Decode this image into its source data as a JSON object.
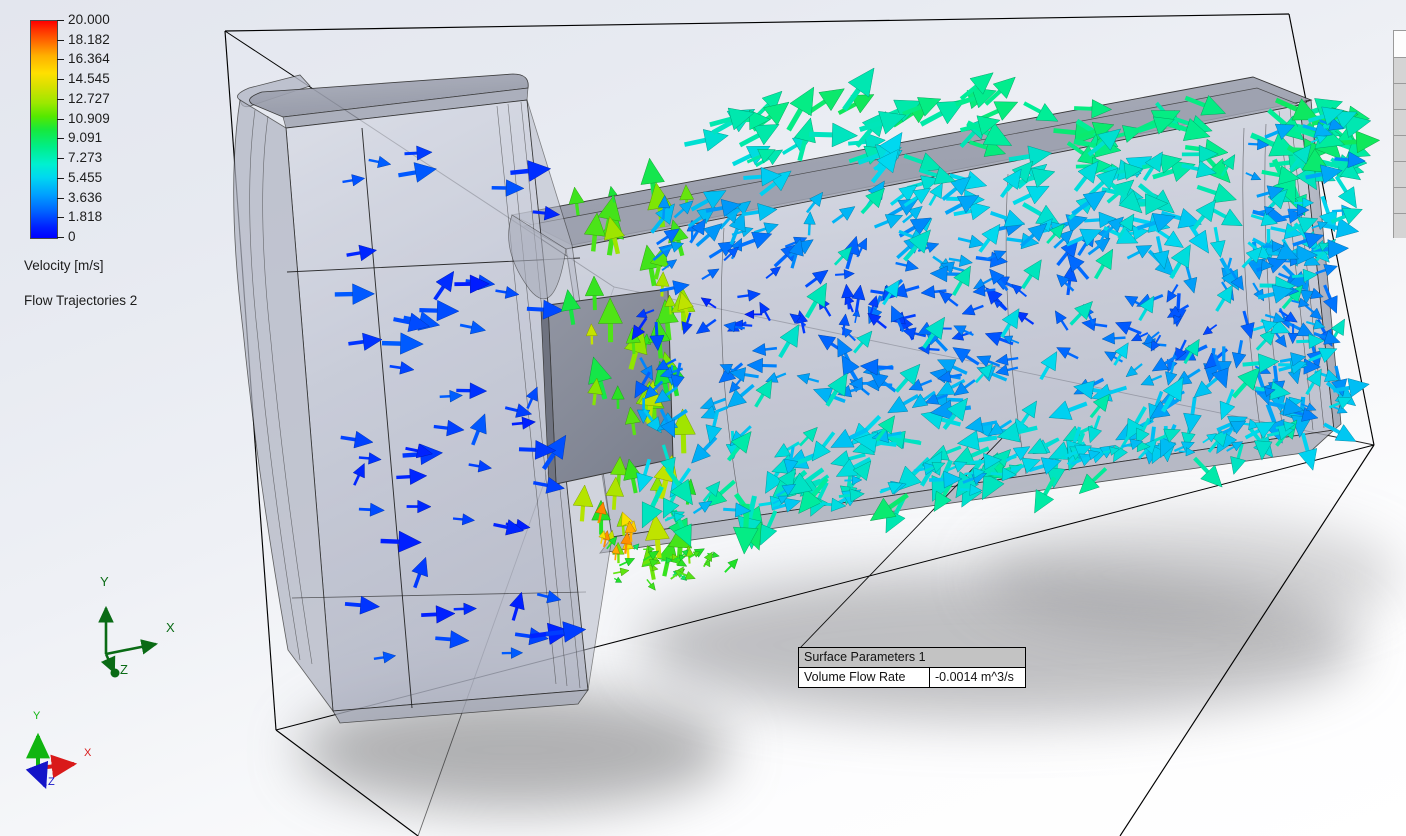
{
  "legend": {
    "bar_name": "velocity-colorbar",
    "values": [
      "20.000",
      "18.182",
      "16.364",
      "14.545",
      "12.727",
      "10.909",
      "9.091",
      "7.273",
      "5.455",
      "3.636",
      "1.818",
      "0"
    ],
    "title": "Velocity [m/s]",
    "plot_name": "Flow Trajectories 2",
    "colors": {
      "max": "#ff0000",
      "mid": "#00ee00",
      "min": "#0000ff"
    }
  },
  "triads": {
    "model": {
      "name": "model-coordinate-triad",
      "x_label": "X",
      "y_label": "Y",
      "z_label": "Z",
      "color": "#0a6b15"
    },
    "view": {
      "name": "view-orientation-triad",
      "x_label": "X",
      "y_label": "Y",
      "z_label": "Z",
      "x_color": "#d91a1a",
      "y_color": "#11b511",
      "z_color": "#1414c8"
    }
  },
  "callout": {
    "title": "Surface Parameters 1",
    "label": "Volume Flow Rate",
    "value": "-0.0014 m^3/s",
    "header_color": "#c3c3c3"
  },
  "scene": {
    "name": "flow-simulation-3d-view",
    "domain_box_color": "#000000",
    "body_color": "#b9bdcc",
    "plate_color": "#8b8f9c",
    "shadow_color": "#8a8a8a"
  },
  "chart_data": {
    "type": "heatmap",
    "title": "Velocity [m/s]",
    "subtitle": "Flow Trajectories 2",
    "legend_position": "top-left",
    "colormap": "rainbow",
    "ylim": [
      0,
      20
    ],
    "tick_values": [
      20.0,
      18.182,
      16.364,
      14.545,
      12.727,
      10.909,
      9.091,
      7.273,
      5.455,
      3.636,
      1.818,
      0
    ],
    "ylabel": "Velocity [m/s]",
    "annotations": [
      {
        "label": "Surface Parameters 1",
        "field": "Volume Flow Rate",
        "value": "-0.0014 m^3/s"
      }
    ]
  }
}
